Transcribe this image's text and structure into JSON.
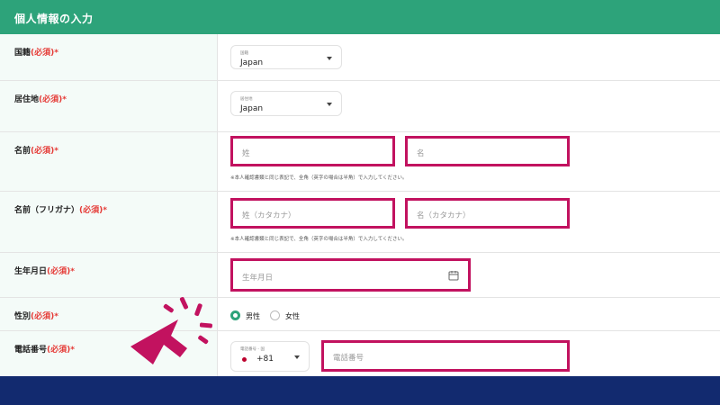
{
  "header": {
    "title": "個人情報の入力"
  },
  "form": {
    "nationality": {
      "label": "国籍",
      "required": "(必須)*",
      "small": "国籍",
      "value": "Japan"
    },
    "residence": {
      "label": "居住地",
      "required": "(必須)*",
      "small": "居住地",
      "value": "Japan"
    },
    "name": {
      "label": "名前",
      "required": "(必須)*",
      "last_placeholder": "姓",
      "first_placeholder": "名",
      "note": "※本人確認書類と同じ表記で、全角（英字の場合は半角）で入力してください。"
    },
    "name_kana": {
      "label": "名前（フリガナ）",
      "required": "(必須)*",
      "last_placeholder": "姓（カタカナ）",
      "first_placeholder": "名（カタカナ）",
      "note": "※本人確認書類と同じ表記で、全角（英字の場合は半角）で入力してください。"
    },
    "birthdate": {
      "label": "生年月日",
      "required": "(必須)*",
      "placeholder": "生年月日"
    },
    "gender": {
      "label": "性別",
      "required": "(必須)*",
      "options": [
        "男性",
        "女性"
      ],
      "selected": "男性"
    },
    "phone": {
      "label": "電話番号",
      "required": "(必須)*",
      "code_small": "電話番号 - 国",
      "code_value": "+81",
      "placeholder": "電話番号"
    }
  },
  "colors": {
    "header": "#2da37a",
    "highlight": "#c2125f",
    "required": "#e53935",
    "footer": "#122a6f"
  },
  "icons": [
    "calendar-icon",
    "chevron-down-icon",
    "japan-flag-icon",
    "click-pointer-icon"
  ]
}
